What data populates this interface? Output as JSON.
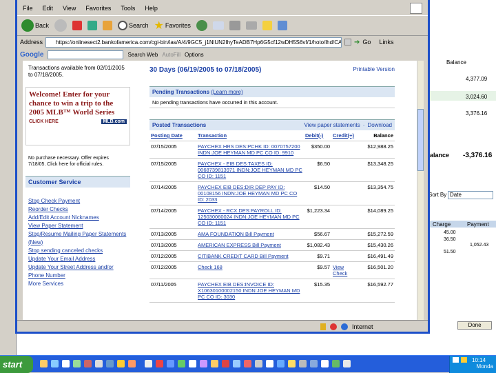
{
  "menu": [
    "File",
    "Edit",
    "View",
    "Favorites",
    "Tools",
    "Help"
  ],
  "toolbar": {
    "back": "Back",
    "search": "Search",
    "favorites": "Favorites"
  },
  "address": {
    "label": "Address",
    "url": "https://onlinesect2.bankofamerica.com/cgi-bin/ias/A/4/9GC5_j1NlUN2IhyTeADB7Hp6G5cf12wDH5S6vf/1/hoto/lhd/CAGC",
    "go": "Go",
    "links": "Links"
  },
  "google": {
    "logo": "Google",
    "search_web": "Search Web",
    "autofill": "AutoFill",
    "options": "Options"
  },
  "left": {
    "avail_text": "Transactions available from 02/01/2005 to 07/18/2005.",
    "promo_title": "Welcome! Enter for your chance to win a trip to the 2005 MLB™ World Series",
    "promo_click": "CLICK HERE",
    "promo_logo": "MLB.com",
    "promo_fine": "No purchase necessary. Offer expires 7/18/05. Click here for official rules.",
    "cs_title": "Customer Service",
    "cs_items": [
      "Stop Check Payment",
      "Reorder Checks",
      "Add/Edit Account Nicknames",
      "View Paper Statement",
      "Stop/Resume Mailing Paper Statements (New)",
      "Stop sending canceled checks",
      "Update Your Email Address",
      "Update Your Street Address and/or Phone Number",
      "More Services"
    ]
  },
  "right": {
    "title": "30 Days (06/19/2005 to 07/18/2005)",
    "printable": "Printable Version",
    "pending_title": "Pending Transactions",
    "pending_link": "(Learn more)",
    "pending_none": "No pending transactions have occurred in this account.",
    "posted_title": "Posted Transactions",
    "view_paper": "View paper statements",
    "download": "Download",
    "cols": [
      "Posting Date",
      "Transaction",
      "Debit(-)",
      "Credit(+)",
      "Balance"
    ],
    "rows": [
      {
        "date": "07/15/2005",
        "desc": "PAYCHEX HRS DES:PCHK ID: 0070757200 INDN:JOE HEYMAN MD PC CO ID: 9910",
        "amt": "$350.00",
        "bal": "$12,988.25"
      },
      {
        "date": "07/15/2005",
        "desc": "PAYCHEX - EIB DES:TAXES ID: 0068739813971 INDN:JOE HEYMAN MD PC CO ID: 1151",
        "amt": "$6.50",
        "bal": "$13,348.25"
      },
      {
        "date": "07/14/2005",
        "desc": "PAYCHEX EIB DES:DIR DEP PAY ID: 00108156 INDN:JOE HEYMAN MD PC CO ID: 2033",
        "amt": "$14.50",
        "bal": "$13,354.75"
      },
      {
        "date": "07/14/2005",
        "desc": "PAYCHEX - RCX DES:PAYROLL ID: 125030060024 INDN:JOE HEYMAN MD PC CO ID: 1151",
        "amt": "$1,223.34",
        "bal": "$14,089.25"
      },
      {
        "date": "07/13/2005",
        "desc": "AMA FOUNDATION Bill Payment",
        "amt": "$56.67",
        "bal": "$15,272.59"
      },
      {
        "date": "07/13/2005",
        "desc": "AMERICAN EXPRESS Bill Payment",
        "amt": "$1,082.43",
        "bal": "$15,430.26"
      },
      {
        "date": "07/12/2005",
        "desc": "CITIBANK CREDIT CARD Bill Payment",
        "amt": "$9.71",
        "bal": "$16,491.49"
      },
      {
        "date": "07/12/2005",
        "desc": "Check 168",
        "amt": "$9.57",
        "bal": "$16,501.20",
        "view": "View Check"
      },
      {
        "date": "07/11/2005",
        "desc": "PAYCHEX EIB DES:INVOICE ID: X10630100002150 INDN:JOE HEYMAN MD PC CO ID: 3030",
        "amt": "$15.35",
        "bal": "$16,592.77"
      }
    ]
  },
  "status": {
    "zone": "Internet"
  },
  "bg": {
    "col1": "Balance",
    "vals": [
      "4,377.09",
      "3,024.60",
      "3,376.16"
    ],
    "balance_label": "alance",
    "balance_val": "-3,376.16",
    "sort_label": "Sort By",
    "sort_val": "Date",
    "charge": "Charge",
    "payment": "Payment",
    "charge_vals": [
      "45.00",
      "36.50",
      "51.50"
    ],
    "payment_val": "1,052.43",
    "done": "Done"
  },
  "taskbar": {
    "start": "start",
    "time": "10:14",
    "day": "Monda"
  }
}
